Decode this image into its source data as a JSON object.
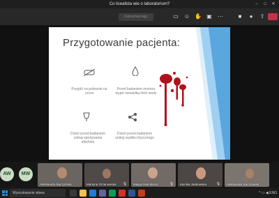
{
  "window": {
    "title": "Co licealista wie o laboratorium?"
  },
  "toolbar": {
    "time": "",
    "stop_label": "Zatrzymaj (button text faded)",
    "icons": [
      "chat-icon",
      "participants-icon",
      "raise-hand-icon",
      "breakout-icon",
      "more-icon",
      "camera-icon",
      "mic-icon",
      "share-icon",
      "leave-icon"
    ]
  },
  "slide": {
    "title": "Przygotowanie pacjenta:",
    "items": [
      {
        "icon": "no-food-icon",
        "text": "Przyjdź na pobranie na czczo"
      },
      {
        "icon": "water-drop-icon",
        "text": "Przed badaniem możesz wypić niewielką ilość wody"
      },
      {
        "icon": "wine-glass-icon",
        "text": "Dzień przed badaniem unikaj spożywania alkoholu"
      },
      {
        "icon": "network-icon",
        "text": "Dzień przed badaniem unikaj wysiłku fizycznego"
      }
    ],
    "accent_color": "#5aa6df",
    "blood_color": "#b0121b"
  },
  "participants": {
    "avatars": [
      {
        "initials": "AW"
      },
      {
        "initials": "MW"
      }
    ],
    "tiles": [
      {
        "name": "Aleksandra Bączyńska",
        "mic_off": true
      },
      {
        "name": "Martyna Grzanowska",
        "mic_off": true
      },
      {
        "name": "Małgorzata Mazur",
        "mic_off": true
      },
      {
        "name": "Monika Jankowska",
        "mic_off": true
      },
      {
        "name": "Aleksander Kaczmarek",
        "mic_off": true
      }
    ]
  },
  "taskbar": {
    "search_placeholder": "Wyszukiwanie słowa",
    "time": "",
    "tray": "^ ▭ ◀ ENG"
  }
}
